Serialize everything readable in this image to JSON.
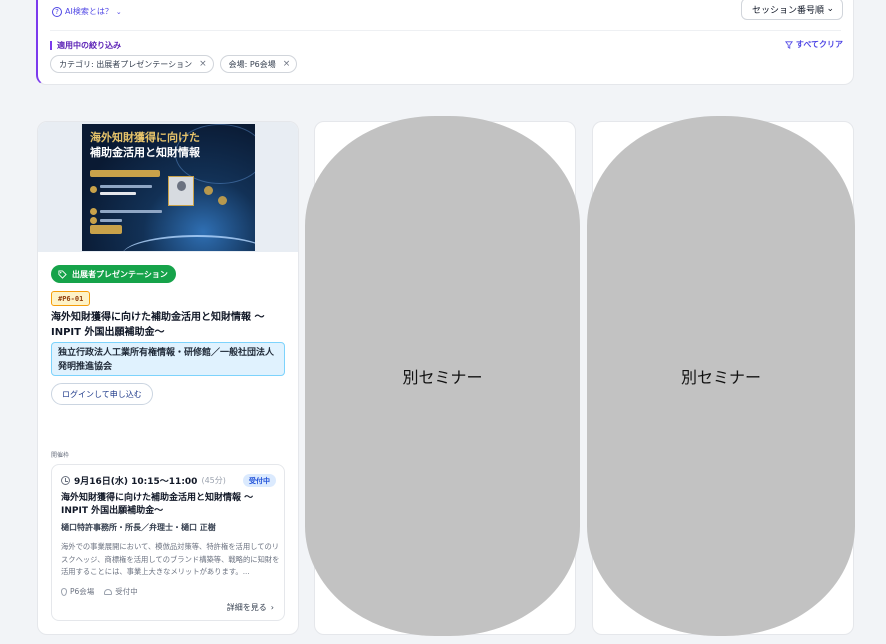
{
  "filter_panel": {
    "ai_help_label": "AI検索とは？",
    "sort_label": "セッション番号順",
    "active_filters_title": "適用中の絞り込み",
    "clear_all_label": "すべてクリア",
    "chips": [
      {
        "label": "カテゴリ: 出展者プレゼンテーション"
      },
      {
        "label": "会場: P6会場"
      }
    ]
  },
  "card": {
    "thumbnail": {
      "title_line1": "海外知財獲得に向けた",
      "title_line2": "補助金活用と知財情報"
    },
    "category_badge": "出展者プレゼンテーション",
    "session_code": "#P6-01",
    "title": "海外知財獲得に向けた補助金活用と知財情報 〜INPIT 外国出願補助金〜",
    "organization": "独立行政法人工業所有権情報・研修館／一般社団法人発明推進協会",
    "login_button": "ログインして申し込む",
    "slots_section_label": "開催枠",
    "slot": {
      "time": "9月16日(水) 10:15〜11:00",
      "duration": "(45分)",
      "status": "受付中",
      "title": "海外知財獲得に向けた補助金活用と知財情報 〜INPIT 外国出願補助金〜",
      "speaker": "樋口特許事務所・所長／弁理士・樋口 正樹",
      "description": "海外での事業展開において、模倣品対策等、特許権を活用してのリスクヘッジ、商標権を活用してのブランド構築等、戦略的に知財を活用することには、事業上大きなメリットがあります。...",
      "venue": "P6会場",
      "reception": "受付中",
      "details_link": "詳細を見る"
    }
  },
  "overlays": [
    {
      "label": "別セミナー"
    },
    {
      "label": "別セミナー"
    }
  ],
  "colors": {
    "accent": "#7c3aed",
    "category_green": "#16a34a",
    "org_bg": "#e0f2fe",
    "overlay_gray": "#c2c2c2"
  }
}
